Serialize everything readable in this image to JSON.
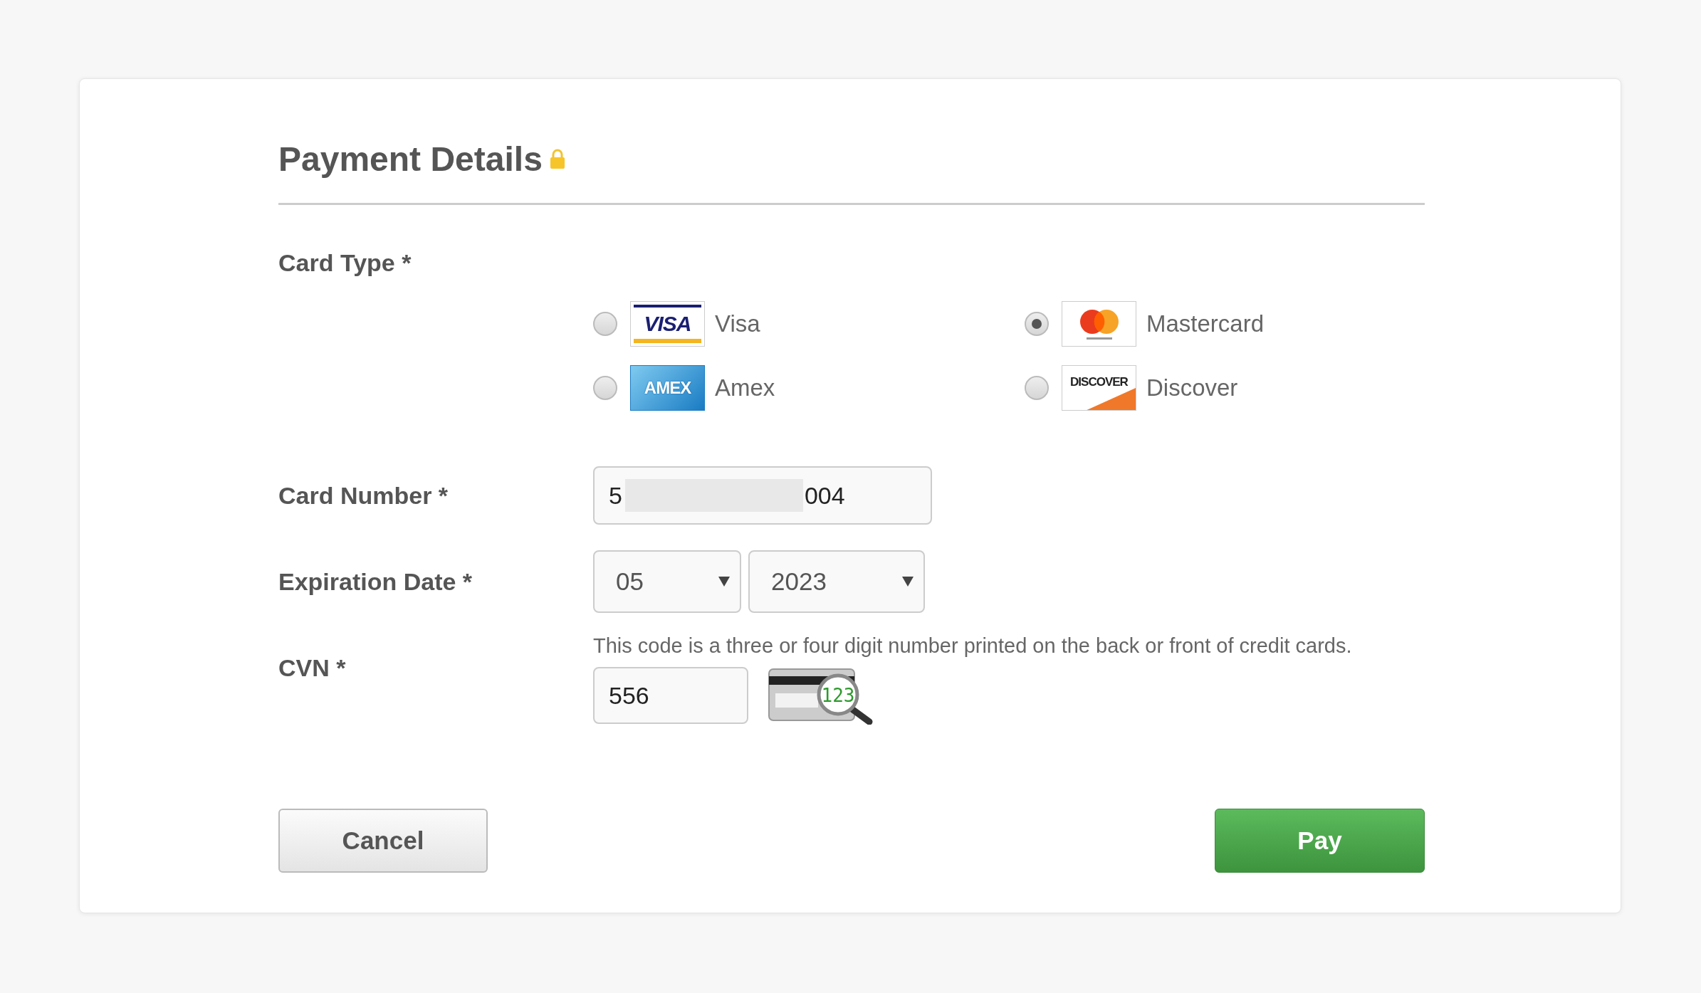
{
  "title": "Payment Details",
  "card_type": {
    "label": "Card Type *",
    "options": [
      {
        "kind": "visa",
        "logo_text": "VISA",
        "label": "Visa",
        "selected": false
      },
      {
        "kind": "mastercard",
        "label": "Mastercard",
        "selected": true
      },
      {
        "kind": "amex",
        "logo_text": "AMEX",
        "label": "Amex",
        "selected": false
      },
      {
        "kind": "discover",
        "logo_text": "DISCOVER",
        "label": "Discover",
        "selected": false
      }
    ]
  },
  "card_number": {
    "label": "Card Number *",
    "value_start": "5",
    "value_end": "004"
  },
  "expiration": {
    "label": "Expiration Date *",
    "month": "05",
    "year": "2023"
  },
  "cvn": {
    "label": "CVN *",
    "help": "This code is a three or four digit number printed on the back or front of credit cards.",
    "value": "556",
    "icon_digits": "123"
  },
  "buttons": {
    "cancel": "Cancel",
    "pay": "Pay"
  }
}
